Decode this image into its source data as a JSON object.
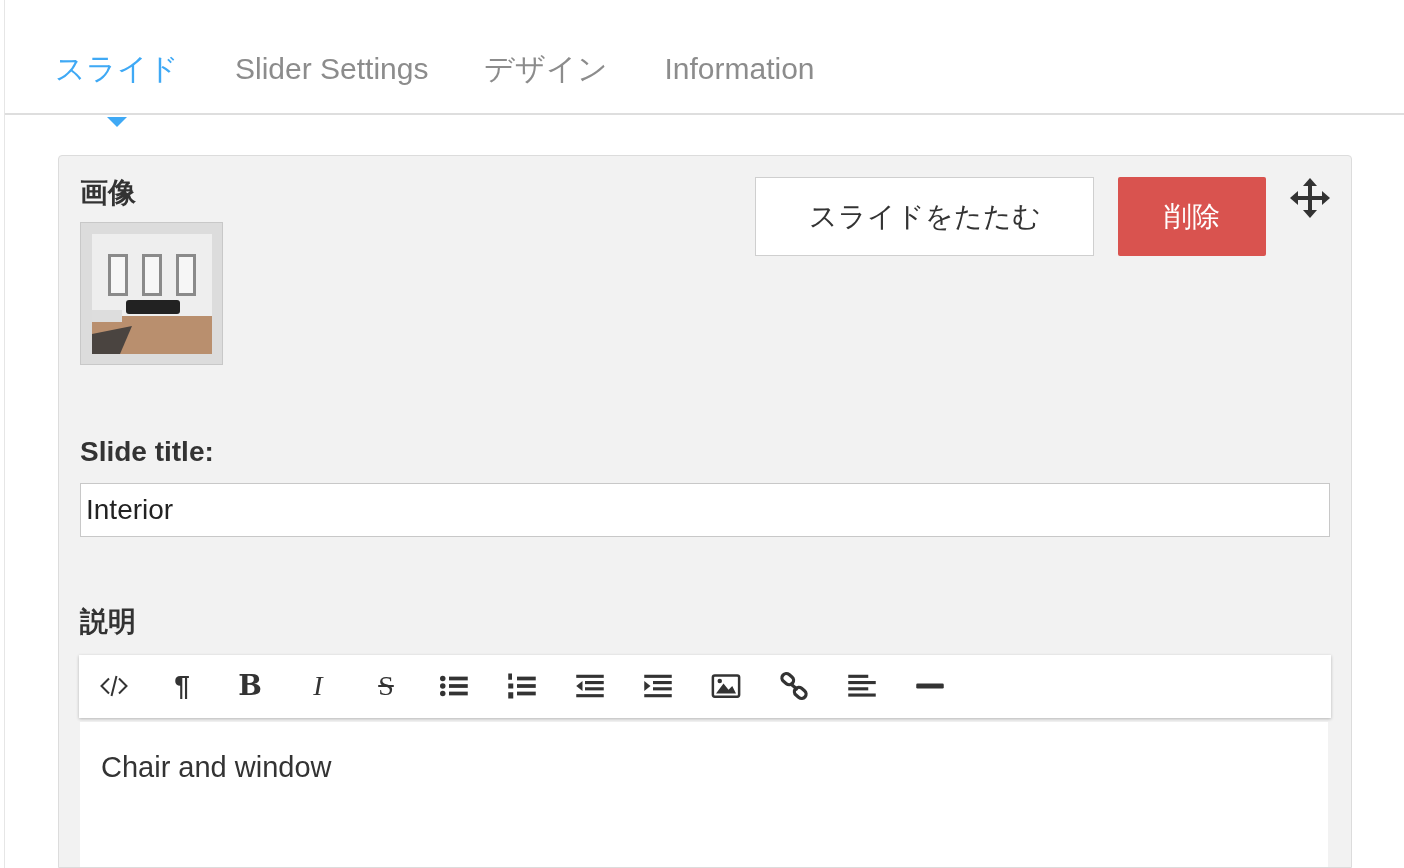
{
  "tabs": [
    {
      "label": "スライド",
      "selected": true
    },
    {
      "label": "Slider Settings",
      "selected": false
    },
    {
      "label": "デザイン",
      "selected": false
    },
    {
      "label": "Information",
      "selected": false
    }
  ],
  "slide": {
    "image_label": "画像",
    "collapse_button": "スライドをたたむ",
    "delete_button": "削除",
    "title_label": "Slide title:",
    "title_value": "Interior",
    "description_label": "説明",
    "toolbar": [
      {
        "kind": "icon"
      },
      {
        "kind": "glyph",
        "text": "¶"
      },
      {
        "kind": "glyph",
        "text": "B"
      },
      {
        "kind": "glyph",
        "text": "I"
      },
      {
        "kind": "glyph",
        "text": "S"
      },
      {
        "kind": "icon"
      },
      {
        "kind": "icon"
      },
      {
        "kind": "icon"
      },
      {
        "kind": "icon"
      },
      {
        "kind": "icon"
      },
      {
        "kind": "icon"
      },
      {
        "kind": "icon"
      },
      {
        "kind": "icon"
      }
    ],
    "description_text": "Chair and window"
  }
}
